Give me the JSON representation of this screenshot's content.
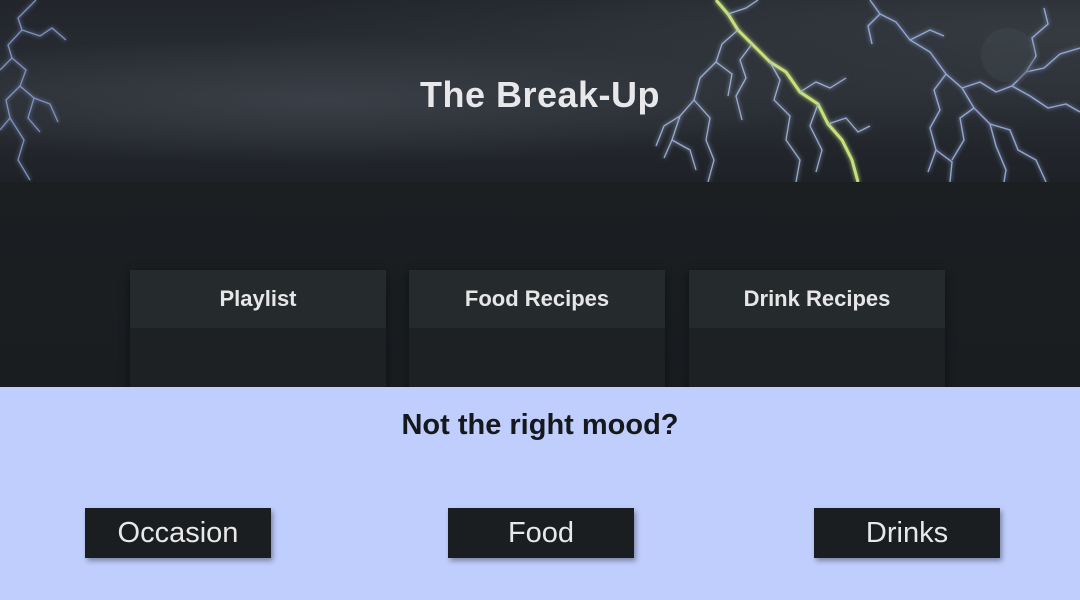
{
  "hero": {
    "title": "The Break-Up"
  },
  "cards": [
    {
      "label": "Playlist"
    },
    {
      "label": "Food Recipes"
    },
    {
      "label": "Drink Recipes"
    }
  ],
  "mood": {
    "question": "Not the right mood?",
    "buttons": [
      {
        "label": "Occasion"
      },
      {
        "label": "Food"
      },
      {
        "label": "Drinks"
      }
    ]
  },
  "colors": {
    "hero_bg": "#22262c",
    "lightning": "#c6e07a",
    "lightning_branch": "#a7b9e0",
    "dark_section": "#1b1f22",
    "card_header": "#252a2d",
    "mood_bg": "#c0cefe",
    "button_bg": "#1a1e21"
  }
}
